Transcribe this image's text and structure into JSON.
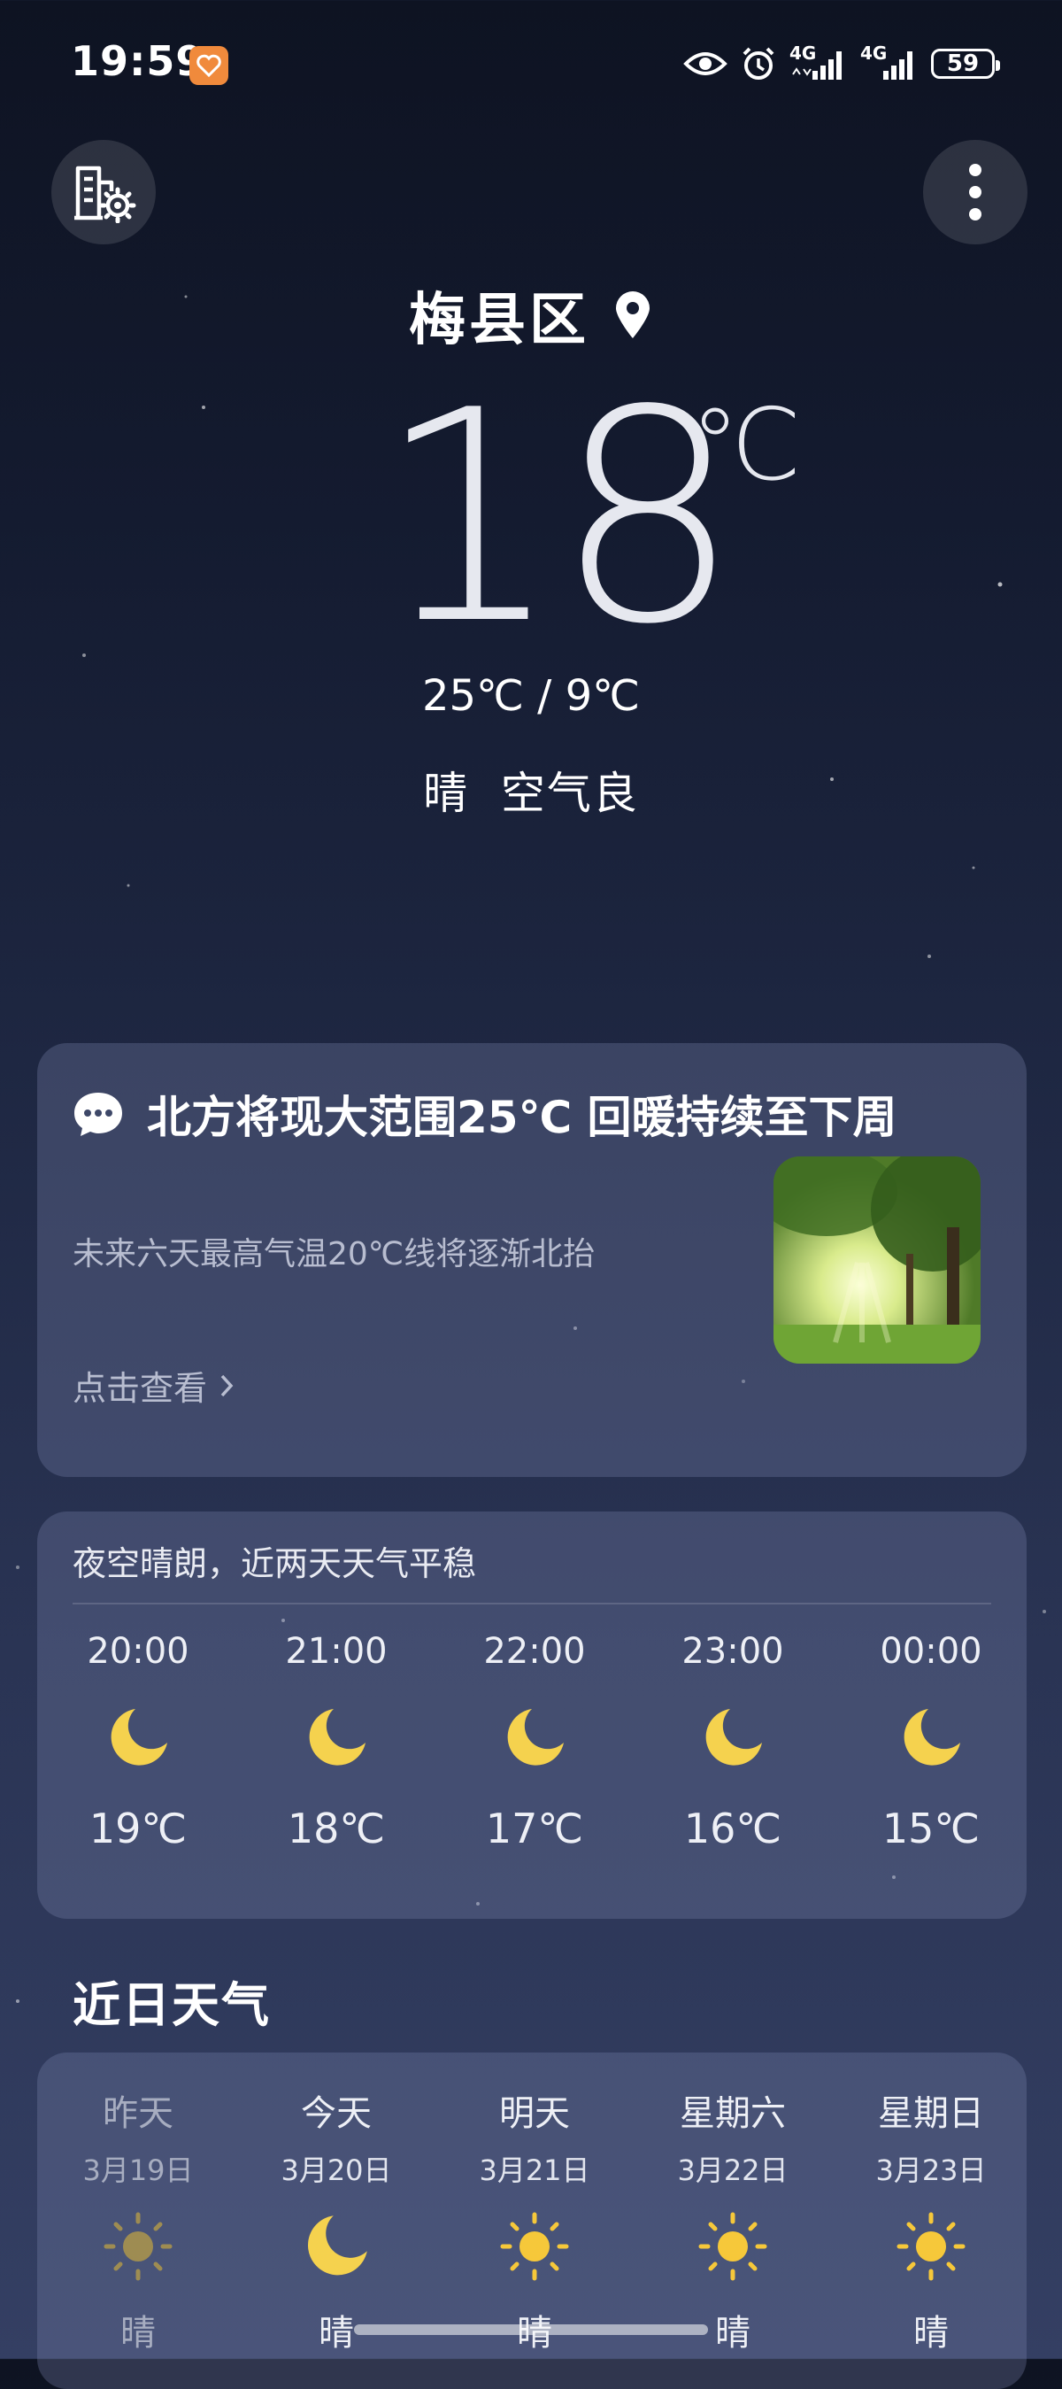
{
  "status_bar": {
    "time": "19:59",
    "network_1": "4G",
    "network_2": "4G",
    "battery": "59"
  },
  "header": {
    "city": "梅县区"
  },
  "current": {
    "temperature": "18",
    "unit": "℃",
    "range": "25℃ / 9℃",
    "condition": "晴",
    "air_quality": "空气良"
  },
  "news": {
    "title": "北方将现大范围25℃ 回暖持续至下周",
    "subtitle": "未来六天最高气温20℃线将逐渐北抬",
    "link": "点击查看"
  },
  "hourly": {
    "summary": "夜空晴朗，近两天天气平稳",
    "items": [
      {
        "time": "20:00",
        "icon": "moon-icon",
        "temp": "19℃"
      },
      {
        "time": "21:00",
        "icon": "moon-icon",
        "temp": "18℃"
      },
      {
        "time": "22:00",
        "icon": "moon-icon",
        "temp": "17℃"
      },
      {
        "time": "23:00",
        "icon": "moon-icon",
        "temp": "16℃"
      },
      {
        "time": "00:00",
        "icon": "moon-icon",
        "temp": "15℃"
      }
    ]
  },
  "daily": {
    "title": "近日天气",
    "items": [
      {
        "day": "昨天",
        "date": "3月19日",
        "icon": "sun-icon",
        "cond": "晴"
      },
      {
        "day": "今天",
        "date": "3月20日",
        "icon": "moon-icon",
        "cond": "晴"
      },
      {
        "day": "明天",
        "date": "3月21日",
        "icon": "sun-icon",
        "cond": "晴"
      },
      {
        "day": "星期六",
        "date": "3月22日",
        "icon": "sun-icon",
        "cond": "晴"
      },
      {
        "day": "星期日",
        "date": "3月23日",
        "icon": "sun-icon",
        "cond": "晴"
      }
    ]
  },
  "colors": {
    "moon": "#f5d24e",
    "sun": "#f6c83a",
    "background_top": "#0e1322",
    "background_bottom": "#343f63"
  }
}
